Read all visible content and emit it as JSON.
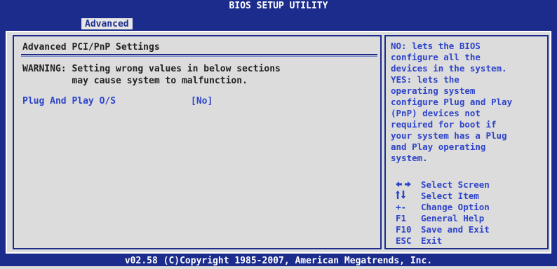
{
  "header": {
    "title": "BIOS SETUP UTILITY",
    "active_tab": "Advanced"
  },
  "main": {
    "section_title": "Advanced PCI/PnP Settings",
    "warning_line1": "WARNING: Setting wrong values in below sections",
    "warning_line2": "         may cause system to malfunction.",
    "settings": [
      {
        "label": "Plug And Play O/S",
        "value": "[No]"
      }
    ]
  },
  "help": {
    "lines": [
      "NO: lets the BIOS",
      "configure all the",
      "devices in the system.",
      "YES: lets the",
      "operating system",
      "configure Plug and Play",
      "(PnP) devices not",
      "required for boot if",
      "your system has a Plug",
      "and Play operating",
      "system."
    ]
  },
  "keys": [
    {
      "icon": "left-right-arrows-icon",
      "key": "",
      "desc": "Select Screen"
    },
    {
      "icon": "up-down-arrows-icon",
      "key": "",
      "desc": "Select Item"
    },
    {
      "icon": "",
      "key": "+-",
      "desc": "Change Option"
    },
    {
      "icon": "",
      "key": "F1",
      "desc": "General Help"
    },
    {
      "icon": "",
      "key": "F10",
      "desc": "Save and Exit"
    },
    {
      "icon": "",
      "key": "ESC",
      "desc": "Exit"
    }
  ],
  "footer": {
    "text": "v02.58 (C)Copyright 1985-2007, American Megatrends, Inc."
  },
  "colors": {
    "bios_blue": "#1c2c8c",
    "panel_gray": "#dcdcdc",
    "highlight_text": "#2e44c9"
  }
}
